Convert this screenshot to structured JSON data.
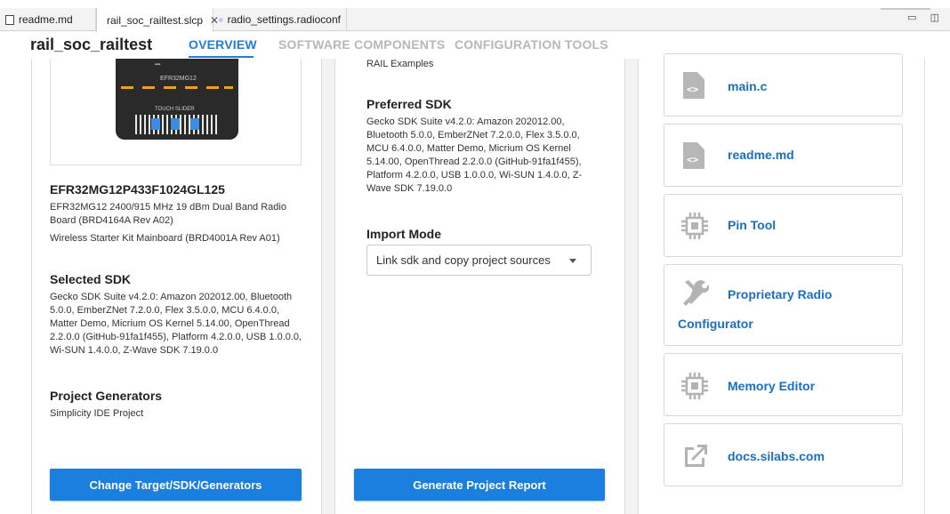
{
  "tabs": [
    {
      "label": "readme.md",
      "icon": "file-icon"
    },
    {
      "label": "rail_soc_railtest.slcp",
      "icon": "project-icon",
      "close": "✕"
    },
    {
      "label": "radio_settings.radioconf",
      "icon": "radio-config-icon"
    }
  ],
  "header": {
    "project_title": "rail_soc_railtest",
    "nav": [
      "OVERVIEW",
      "SOFTWARE COMPONENTS",
      "CONFIGURATION TOOLS"
    ]
  },
  "left_panel": {
    "board_silk": {
      "chip": "EFR32MG12",
      "slider": "TOUCH SLIDER"
    },
    "part_number": "EFR32MG12P433F1024GL125",
    "board_desc": "EFR32MG12 2400/915 MHz 19 dBm Dual Band Radio Board (BRD4164A Rev A02)",
    "kit_desc": "Wireless Starter Kit Mainboard (BRD4001A Rev A01)",
    "selected_sdk_heading": "Selected SDK",
    "selected_sdk_text": "Gecko SDK Suite v4.2.0: Amazon 202012.00, Bluetooth 5.0.0, EmberZNet 7.2.0.0, Flex 3.5.0.0, MCU 6.4.0.0, Matter Demo, Micrium OS Kernel 5.14.00, OpenThread 2.2.0.0 (GitHub-91fa1f455), Platform 4.2.0.0, USB 1.0.0.0, Wi-SUN 1.4.0.0, Z-Wave SDK 7.19.0.0",
    "generators_heading": "Project Generators",
    "generators_text": "Simplicity IDE Project",
    "change_button": "Change Target/SDK/Generators"
  },
  "middle_panel": {
    "category_text": "RAIL Examples",
    "preferred_sdk_heading": "Preferred SDK",
    "preferred_sdk_text": "Gecko SDK Suite v4.2.0: Amazon 202012.00, Bluetooth 5.0.0, EmberZNet 7.2.0.0, Flex 3.5.0.0, MCU 6.4.0.0, Matter Demo, Micrium OS Kernel 5.14.00, OpenThread 2.2.0.0 (GitHub-91fa1f455), Platform 4.2.0.0, USB 1.0.0.0, Wi-SUN 1.4.0.0, Z-Wave SDK 7.19.0.0",
    "import_mode_heading": "Import Mode",
    "import_mode_value": "Link sdk and copy project sources",
    "report_button": "Generate Project Report"
  },
  "right_panel": {
    "tools": [
      {
        "label": "main.c",
        "icon": "source-file-icon"
      },
      {
        "label": "readme.md",
        "icon": "source-file-icon"
      },
      {
        "label": "Pin Tool",
        "icon": "chip-icon"
      },
      {
        "label_line1": "Proprietary Radio",
        "label_line2": "Configurator",
        "icon": "wrench-screwdriver-icon"
      },
      {
        "label": "Memory Editor",
        "icon": "chip-icon"
      },
      {
        "label": "docs.silabs.com",
        "icon": "external-link-icon"
      }
    ]
  },
  "colors": {
    "accent": "#1f7fd8",
    "button": "#1a7fde",
    "link": "#1a6fc0",
    "panel_bg": "#f3f3f3"
  }
}
